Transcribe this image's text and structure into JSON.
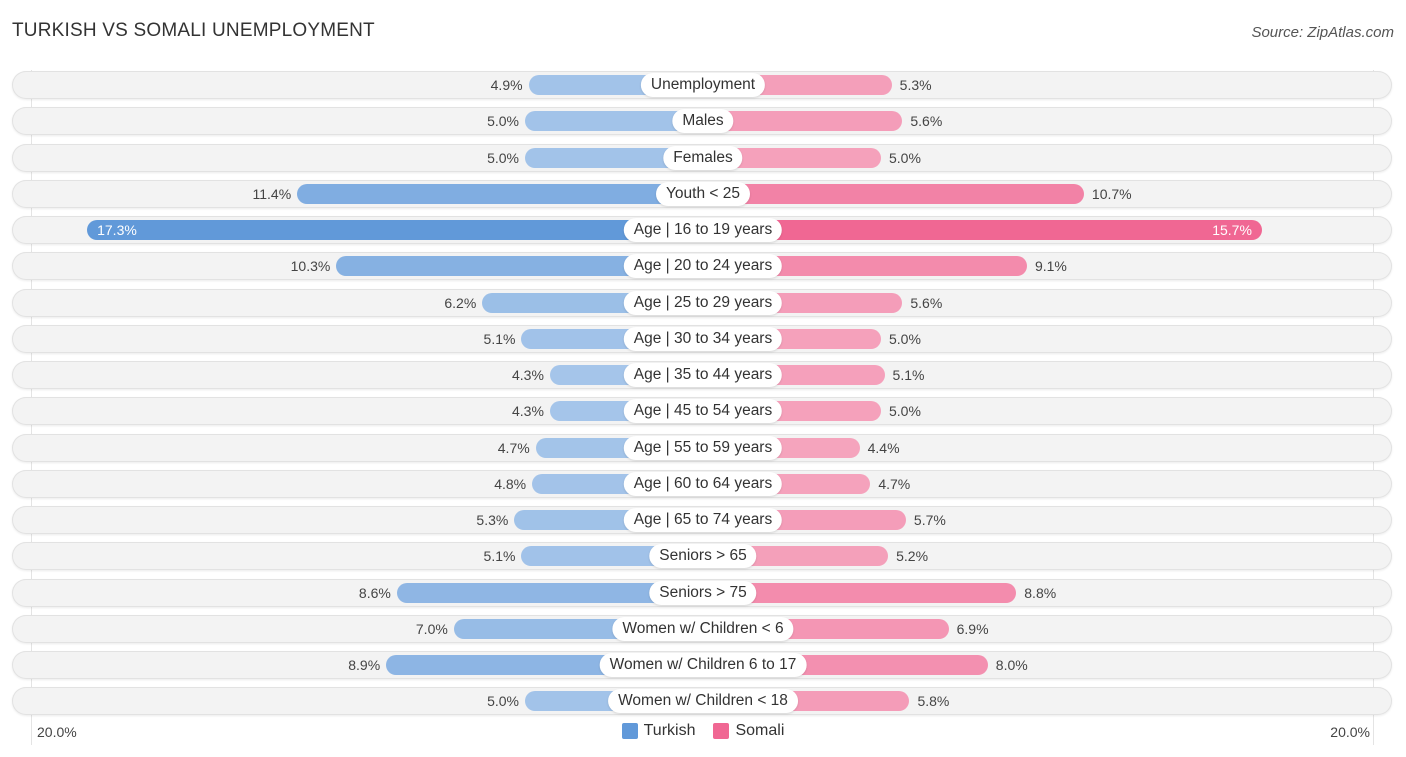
{
  "header": {
    "title": "TURKISH VS SOMALI UNEMPLOYMENT",
    "source": "Source: ZipAtlas.com"
  },
  "colors": {
    "turkish": "#6199d9",
    "turkish_light": "#a7c6ea",
    "somali": "#f06793",
    "somali_light": "#f5a6bf"
  },
  "chart_data": {
    "type": "bar",
    "orientation": "horizontal-diverging",
    "title": "TURKISH VS SOMALI UNEMPLOYMENT",
    "xlabel": "",
    "ylabel": "",
    "xlim": [
      -20.0,
      20.0
    ],
    "axis_labels": {
      "left": "20.0%",
      "right": "20.0%"
    },
    "legend_position": "bottom-center",
    "categories": [
      "Unemployment",
      "Males",
      "Females",
      "Youth < 25",
      "Age | 16 to 19 years",
      "Age | 20 to 24 years",
      "Age | 25 to 29 years",
      "Age | 30 to 34 years",
      "Age | 35 to 44 years",
      "Age | 45 to 54 years",
      "Age | 55 to 59 years",
      "Age | 60 to 64 years",
      "Age | 65 to 74 years",
      "Seniors > 65",
      "Seniors > 75",
      "Women w/ Children < 6",
      "Women w/ Children 6 to 17",
      "Women w/ Children < 18"
    ],
    "series": [
      {
        "name": "Turkish",
        "side": "left",
        "values": [
          4.9,
          5.0,
          5.0,
          11.4,
          17.3,
          10.3,
          6.2,
          5.1,
          4.3,
          4.3,
          4.7,
          4.8,
          5.3,
          5.1,
          8.6,
          7.0,
          8.9,
          5.0
        ],
        "labels": [
          "4.9%",
          "5.0%",
          "5.0%",
          "11.4%",
          "17.3%",
          "10.3%",
          "6.2%",
          "5.1%",
          "4.3%",
          "4.3%",
          "4.7%",
          "4.8%",
          "5.3%",
          "5.1%",
          "8.6%",
          "7.0%",
          "8.9%",
          "5.0%"
        ]
      },
      {
        "name": "Somali",
        "side": "right",
        "values": [
          5.3,
          5.6,
          5.0,
          10.7,
          15.7,
          9.1,
          5.6,
          5.0,
          5.1,
          5.0,
          4.4,
          4.7,
          5.7,
          5.2,
          8.8,
          6.9,
          8.0,
          5.8
        ],
        "labels": [
          "5.3%",
          "5.6%",
          "5.0%",
          "10.7%",
          "15.7%",
          "9.1%",
          "5.6%",
          "5.0%",
          "5.1%",
          "5.0%",
          "4.4%",
          "4.7%",
          "5.7%",
          "5.2%",
          "8.8%",
          "6.9%",
          "8.0%",
          "5.8%"
        ]
      }
    ],
    "highlighted_index": 4
  },
  "legend": {
    "items": [
      {
        "label": "Turkish"
      },
      {
        "label": "Somali"
      }
    ]
  }
}
